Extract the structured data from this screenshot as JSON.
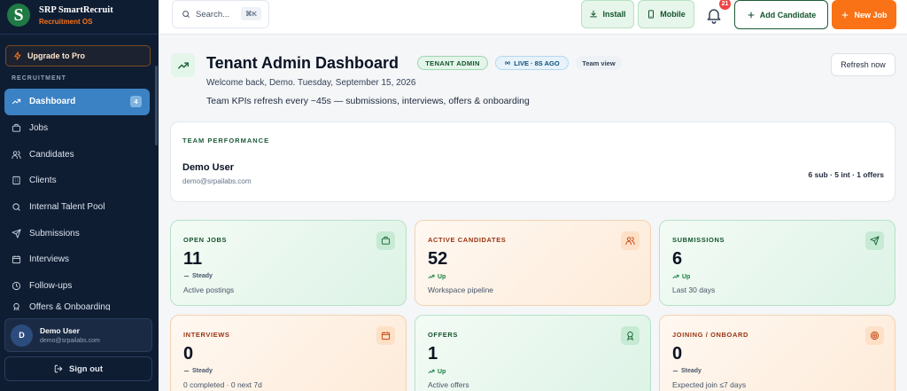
{
  "brand": {
    "name": "SRP SmartRecruit",
    "sub": "Recruitment OS",
    "logo_letter": "S"
  },
  "sidebar": {
    "upgrade_label": "Upgrade to Pro",
    "section_label": "RECRUITMENT",
    "items": [
      {
        "label": "Dashboard",
        "icon": "trend-icon",
        "active": true,
        "badge": "4"
      },
      {
        "label": "Jobs",
        "icon": "briefcase-icon"
      },
      {
        "label": "Candidates",
        "icon": "users-icon"
      },
      {
        "label": "Clients",
        "icon": "building-icon"
      },
      {
        "label": "Internal Talent Pool",
        "icon": "search-icon"
      },
      {
        "label": "Submissions",
        "icon": "send-icon"
      },
      {
        "label": "Interviews",
        "icon": "calendar-icon"
      },
      {
        "label": "Follow-ups",
        "icon": "clock-icon"
      },
      {
        "label": "Offers & Onboarding",
        "icon": "award-icon"
      }
    ],
    "user": {
      "initial": "D",
      "name": "Demo User",
      "email": "demo@srpailabs.com"
    },
    "signout_label": "Sign out"
  },
  "topbar": {
    "search_placeholder": "Search...",
    "search_shortcut": "⌘K",
    "install_label": "Install",
    "mobile_label": "Mobile",
    "notifications_count": "21",
    "add_candidate_label": "Add Candidate",
    "new_job_label": "New Job"
  },
  "header": {
    "title": "Tenant Admin Dashboard",
    "role_pill": "TENANT ADMIN",
    "live_pill": "LIVE · 8S AGO",
    "view_pill": "Team view",
    "welcome": "Welcome back, Demo. Tuesday, September 15, 2026",
    "kpi_note": "Team KPIs refresh every ~45s — submissions, interviews, offers & onboarding",
    "refresh_label": "Refresh now"
  },
  "team_performance": {
    "label": "TEAM PERFORMANCE",
    "user": "Demo User",
    "email": "demo@srpailabs.com",
    "stats": "6 sub · 5 int · 1 offers"
  },
  "kpis": [
    {
      "label": "OPEN JOBS",
      "value": "11",
      "trend": "Steady",
      "sub": "Active postings",
      "icon": "briefcase-icon",
      "tone": "green"
    },
    {
      "label": "ACTIVE CANDIDATES",
      "value": "52",
      "trend": "Up",
      "sub": "Workspace pipeline",
      "icon": "users-icon",
      "tone": "orange"
    },
    {
      "label": "SUBMISSIONS",
      "value": "6",
      "trend": "Up",
      "sub": "Last 30 days",
      "icon": "send-icon",
      "tone": "green"
    },
    {
      "label": "INTERVIEWS",
      "value": "0",
      "trend": "Steady",
      "sub": "0 completed · 0 next 7d",
      "icon": "calendar-icon",
      "tone": "orange"
    },
    {
      "label": "OFFERS",
      "value": "1",
      "trend": "Up",
      "sub": "Active offers",
      "icon": "award-icon",
      "tone": "green"
    },
    {
      "label": "JOINING / ONBOARD",
      "value": "0",
      "trend": "Steady",
      "sub": "Expected join ≤7 days",
      "icon": "target-icon",
      "tone": "orange"
    }
  ],
  "colors": {
    "sidebar_bg": "#0f1d33",
    "accent_blue": "#3b82c4",
    "brand_green": "#1f7a44",
    "accent_orange": "#f97316"
  }
}
